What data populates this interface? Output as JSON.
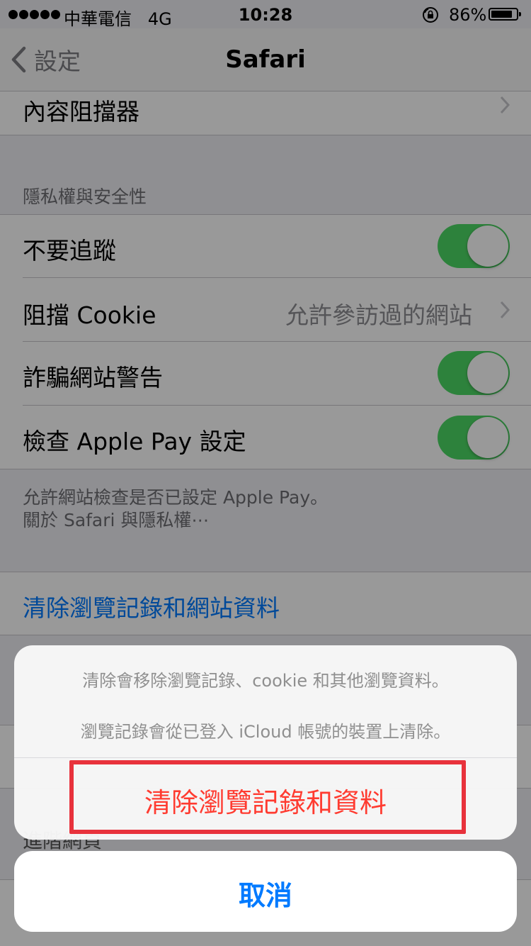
{
  "status_bar": {
    "carrier": "中華電信",
    "network": "4G",
    "time": "10:28",
    "battery_percent": "86%",
    "battery_level": 0.86,
    "signal_bars": 5
  },
  "nav": {
    "back_label": "設定",
    "title": "Safari"
  },
  "rows": {
    "content_blockers": "內容阻擋器",
    "privacy_header": "隱私權與安全性",
    "do_not_track": "不要追蹤",
    "block_cookies": "阻擋 Cookie",
    "block_cookies_value": "允許參訪過的網站",
    "fraud_warning": "詐騙網站警告",
    "check_apple_pay": "檢查 Apple Pay 設定",
    "footer_line1": "允許網站檢查是否已設定 Apple Pay。",
    "footer_line2": "關於 Safari 與隱私權⋯",
    "clear_history": "清除瀏覽記錄和網站資料",
    "behind_sheet_label": "進階網頁"
  },
  "toggles": {
    "do_not_track": true,
    "fraud_warning": true,
    "check_apple_pay": true
  },
  "action_sheet": {
    "message_line1": "清除會移除瀏覽記錄、cookie 和其他瀏覽資料。",
    "message_line2": "瀏覽記錄會從已登入 iCloud 帳號的裝置上清除。",
    "destructive_label": "清除瀏覽記錄和資料",
    "cancel_label": "取消"
  },
  "colors": {
    "toggle_on": "#4cd964",
    "link_blue": "#007aff",
    "destructive_red": "#ff3b30",
    "highlight_red": "#e8323c"
  }
}
